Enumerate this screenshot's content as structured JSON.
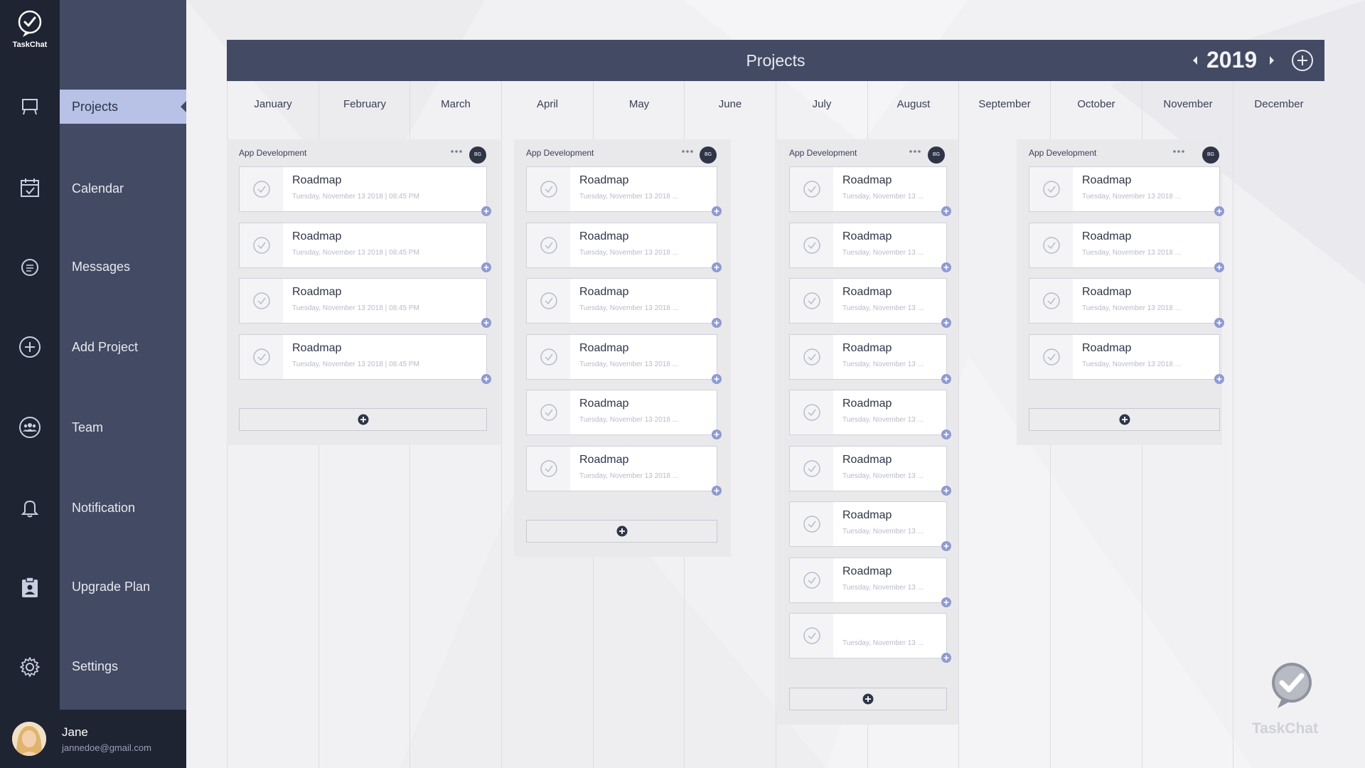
{
  "brand": {
    "name": "TaskChat"
  },
  "nav": {
    "items": [
      {
        "label": "Projects",
        "icon": "projects-icon",
        "active": true
      },
      {
        "label": "Calendar",
        "icon": "calendar-icon"
      },
      {
        "label": "Messages",
        "icon": "messages-icon"
      },
      {
        "label": "Add Project",
        "icon": "add-circle-icon"
      },
      {
        "label": "Team",
        "icon": "team-icon"
      },
      {
        "label": "Notification",
        "icon": "bell-icon"
      },
      {
        "label": "Upgrade Plan",
        "icon": "clipboard-user-icon"
      },
      {
        "label": "Settings",
        "icon": "gear-icon"
      }
    ]
  },
  "user": {
    "name": "Jane",
    "email": "jannedoe@gmail.com"
  },
  "header": {
    "title": "Projects",
    "year": "2019"
  },
  "months": [
    "January",
    "February",
    "March",
    "April",
    "May",
    "June",
    "July",
    "August",
    "September",
    "October",
    "November",
    "December"
  ],
  "groups": [
    {
      "name": "App Development",
      "badge": "BG",
      "cards": [
        {
          "title": "Roadmap",
          "date": "Tuesday, November 13 2018 | 08:45 PM"
        },
        {
          "title": "Roadmap",
          "date": "Tuesday, November 13 2018 | 08:45 PM"
        },
        {
          "title": "Roadmap",
          "date": "Tuesday, November 13 2018 | 08:45 PM"
        },
        {
          "title": "Roadmap",
          "date": "Tuesday, November 13 2018 | 08:45 PM"
        }
      ]
    },
    {
      "name": "App Development",
      "badge": "BG",
      "cards": [
        {
          "title": "Roadmap",
          "date": "Tuesday, November 13 2018 ..."
        },
        {
          "title": "Roadmap",
          "date": "Tuesday, November 13 2018 ..."
        },
        {
          "title": "Roadmap",
          "date": "Tuesday, November 13 2018 ..."
        },
        {
          "title": "Roadmap",
          "date": "Tuesday, November 13 2018 ..."
        },
        {
          "title": "Roadmap",
          "date": "Tuesday, November 13 2018 ..."
        },
        {
          "title": "Roadmap",
          "date": "Tuesday, November 13 2018 ..."
        }
      ]
    },
    {
      "name": "App Development",
      "badge": "BG",
      "cards": [
        {
          "title": "Roadmap",
          "date": "Tuesday, November 13 ..."
        },
        {
          "title": "Roadmap",
          "date": "Tuesday, November 13 ..."
        },
        {
          "title": "Roadmap",
          "date": "Tuesday, November 13 ..."
        },
        {
          "title": "Roadmap",
          "date": "Tuesday, November 13 ..."
        },
        {
          "title": "Roadmap",
          "date": "Tuesday, November 13 ..."
        },
        {
          "title": "Roadmap",
          "date": "Tuesday, November 13 ..."
        },
        {
          "title": "Roadmap",
          "date": "Tuesday, November 13 ..."
        },
        {
          "title": "Roadmap",
          "date": "Tuesday, November 13 ..."
        },
        {
          "title": "",
          "date": "Tuesday, November 13 ..."
        }
      ]
    },
    {
      "name": "App Development",
      "badge": "BG",
      "cards": [
        {
          "title": "Roadmap",
          "date": "Tuesday, November 13 2018 ..."
        },
        {
          "title": "Roadmap",
          "date": "Tuesday, November 13 2018 ..."
        },
        {
          "title": "Roadmap",
          "date": "Tuesday, November 13 2018 ..."
        },
        {
          "title": "Roadmap",
          "date": "Tuesday, November 13 2018 ..."
        }
      ]
    }
  ],
  "watermark": {
    "label": "TaskChat"
  },
  "colors": {
    "accent": "#434a63",
    "active_nav": "#b8c1e6",
    "rail": "#1f2433",
    "plus": "#8e9ad0"
  }
}
